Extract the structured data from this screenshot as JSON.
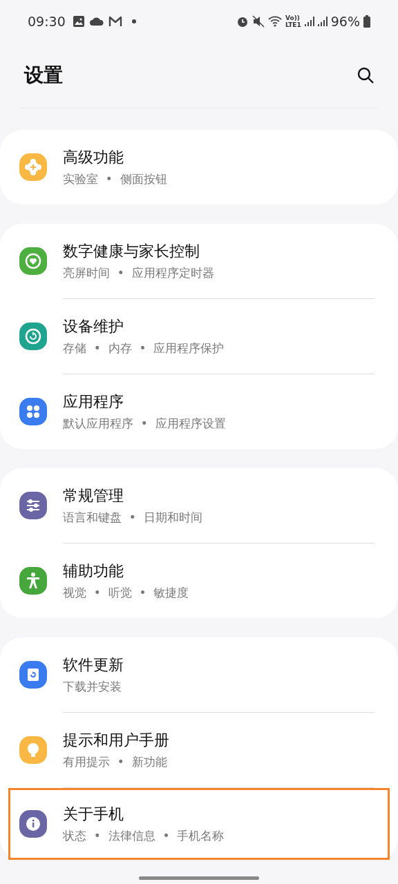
{
  "status_bar": {
    "time": "09:30",
    "network_label": [
      "Vo))",
      "LTE1"
    ],
    "battery": "96%"
  },
  "header": {
    "title": "设置"
  },
  "groups": [
    {
      "items": [
        {
          "kind": "advanced",
          "color": "#f9b843",
          "title": "高级功能",
          "subtitle": "实验室 • 侧面按钮",
          "highlighted": false
        }
      ]
    },
    {
      "items": [
        {
          "kind": "wellbeing",
          "color": "#4caf3f",
          "title": "数字健康与家长控制",
          "subtitle": "亮屏时间 • 应用程序定时器",
          "highlighted": false
        },
        {
          "kind": "care",
          "color": "#1fa58f",
          "title": "设备维护",
          "subtitle": "存储 • 内存 • 应用程序保护",
          "highlighted": false
        },
        {
          "kind": "apps",
          "color": "#3a7cf0",
          "title": "应用程序",
          "subtitle": "默认应用程序 • 应用程序设置",
          "highlighted": false
        }
      ]
    },
    {
      "items": [
        {
          "kind": "general",
          "color": "#6a66a6",
          "title": "常规管理",
          "subtitle": "语言和键盘 • 日期和时间",
          "highlighted": false
        },
        {
          "kind": "accessibility",
          "color": "#46a83c",
          "title": "辅助功能",
          "subtitle": "视觉 • 听觉 • 敏捷度",
          "highlighted": false
        }
      ]
    },
    {
      "items": [
        {
          "kind": "update",
          "color": "#3a7cf0",
          "title": "软件更新",
          "subtitle": "下载并安装",
          "highlighted": false
        },
        {
          "kind": "tips",
          "color": "#f9b843",
          "title": "提示和用户手册",
          "subtitle": "有用提示 • 新功能",
          "highlighted": false
        },
        {
          "kind": "about",
          "color": "#6a66a6",
          "title": "关于手机",
          "subtitle": "状态 • 法律信息 • 手机名称",
          "highlighted": true
        }
      ]
    }
  ]
}
